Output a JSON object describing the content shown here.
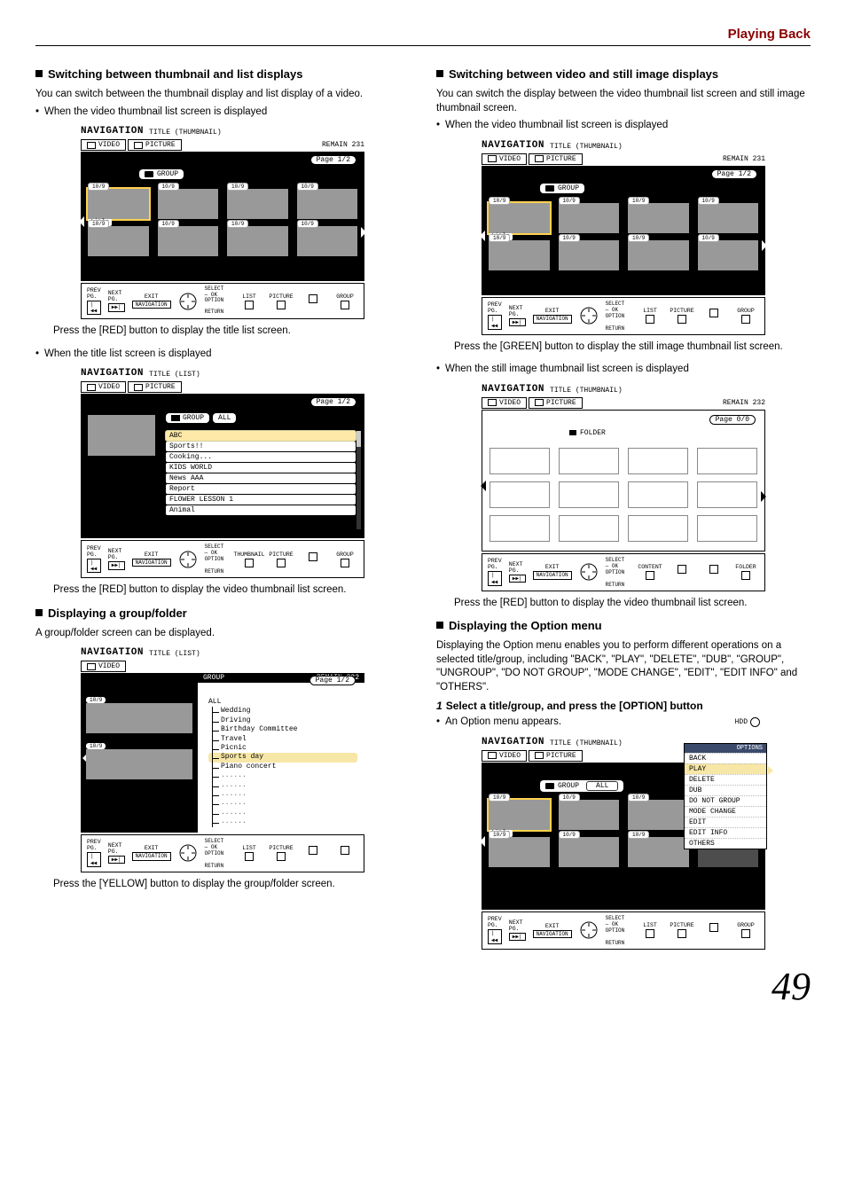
{
  "header": {
    "title": "Playing Back"
  },
  "left": {
    "section1_title": "Switching between thumbnail and list displays",
    "intro": "You can switch between the thumbnail display and list display of a video.",
    "bullet1": "When the video thumbnail list screen is displayed",
    "caption1": "Press the [RED] button to display the title list screen.",
    "bullet2": "When the title list screen is displayed",
    "caption2": "Press the [RED] button to display the video thumbnail list screen.",
    "section2_title": "Displaying a group/folder",
    "section2_text": "A group/folder screen can be displayed.",
    "caption3": "Press the [YELLOW] button to display the group/folder screen."
  },
  "right": {
    "section1_title": "Switching between video and still image displays",
    "intro": "You can switch the display between the video thumbnail list screen and still image thumbnail screen.",
    "bullet1": "When the video thumbnail list screen is displayed",
    "caption1": "Press the [GREEN] button to display the still image thumbnail list screen.",
    "bullet2": "When the still image thumbnail list screen is displayed",
    "caption2": "Press the [RED] button to display the video thumbnail list screen.",
    "section2_title": "Displaying the Option menu",
    "section2_p1": "Displaying the Option menu enables you to perform different operations on a selected title/group, including \"BACK\", \"PLAY\", \"DELETE\", \"DUB\", \"GROUP\", \"UNGROUP\", \"DO NOT GROUP\", \"MODE CHANGE\", \"EDIT\", \"EDIT INFO\" and \"OTHERS\".",
    "step1": "Select a title/group, and press the [OPTION] button",
    "step1_bullet": "An Option menu appears."
  },
  "nav": {
    "title": "NAVIGATION",
    "sub_thumb": "TITLE (THUMBNAIL)",
    "sub_list": "TITLE (LIST)",
    "tab_video": "VIDEO",
    "tab_picture": "PICTURE",
    "remain231": "REMAIN 231",
    "remain232": "REMAIN 232",
    "page12": "Page   1/2",
    "page00": "Page   0/0",
    "group": "GROUP",
    "all": "ALL",
    "folder": "FOLDER",
    "badge": "10/9",
    "sel_title": "title",
    "list_items": [
      "ABC",
      "Sports!!",
      "Cooking...",
      "KIDS WORLD",
      "News AAA",
      "Report",
      "FLOWER LESSON 1",
      "Animal"
    ],
    "gf_header": "GROUP",
    "gf_items": [
      "ALL",
      "Wedding",
      "Driving",
      "Birthday Committee",
      "Travel",
      "Picnic",
      "Sports day",
      "Piano concert",
      "......",
      "......",
      "......",
      "......",
      "......",
      "......"
    ],
    "options_hd": "OPTIONS",
    "hdd": "HDD",
    "options": [
      "BACK",
      "PLAY",
      "DELETE",
      "DUB",
      "DO NOT GROUP",
      "MODE CHANGE",
      "EDIT",
      "EDIT INFO",
      "OTHERS"
    ]
  },
  "bottombar": {
    "prev": "PREV PG.",
    "next": "NEXT PG.",
    "exit": "EXIT",
    "select": "SELECT",
    "ok": "OK",
    "option": "OPTION",
    "return": "RETURN",
    "navigation": "NAVIGATION",
    "prev_icon": "|◀◀",
    "next_icon": "▶▶|",
    "colors_thumb": [
      "LIST",
      "PICTURE",
      "",
      "GROUP"
    ],
    "colors_list": [
      "THUMBNAIL",
      "PICTURE",
      "",
      "GROUP"
    ],
    "colors_gf": [
      "LIST",
      "PICTURE",
      "",
      ""
    ],
    "colors_still": [
      "CONTENT",
      "",
      "",
      "FOLDER"
    ],
    "colors_opt": [
      "LIST",
      "PICTURE",
      "",
      "GROUP"
    ]
  },
  "page_number": "49"
}
